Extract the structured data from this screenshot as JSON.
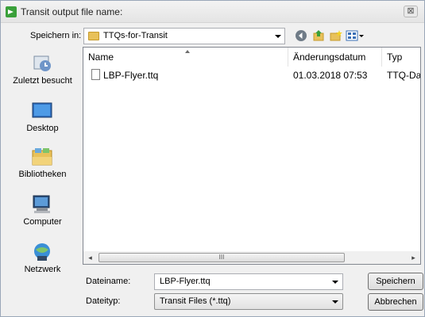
{
  "window": {
    "title": "Transit output file name:",
    "close_glyph": "⊠"
  },
  "toolbar": {
    "save_in_label": "Speichern in:",
    "current_folder": "TTQs-for-Transit",
    "icons": [
      "back-icon",
      "up-folder-icon",
      "new-folder-icon",
      "view-menu-icon"
    ]
  },
  "places": [
    {
      "label": "Zuletzt besucht",
      "icon": "recent-places-icon"
    },
    {
      "label": "Desktop",
      "icon": "desktop-icon"
    },
    {
      "label": "Bibliotheken",
      "icon": "libraries-icon"
    },
    {
      "label": "Computer",
      "icon": "computer-icon"
    },
    {
      "label": "Netzwerk",
      "icon": "network-icon"
    }
  ],
  "filelist": {
    "columns": [
      "Name",
      "Änderungsdatum",
      "Typ"
    ],
    "rows": [
      {
        "name": "LBP-Flyer.ttq",
        "modified": "01.03.2018 07:53",
        "type": "TTQ-Datei"
      }
    ],
    "scroll": {
      "left": "◂",
      "right": "▸",
      "grip": "III"
    }
  },
  "filename": {
    "label": "Dateiname:",
    "value": "LBP-Flyer.ttq"
  },
  "filetype": {
    "label": "Dateityp:",
    "value": "Transit Files (*.ttq)"
  },
  "buttons": {
    "save": "Speichern",
    "cancel": "Abbrechen"
  },
  "colors": {
    "accent": "#3aa03a",
    "folder": "#e8c15a",
    "border": "#828790"
  }
}
